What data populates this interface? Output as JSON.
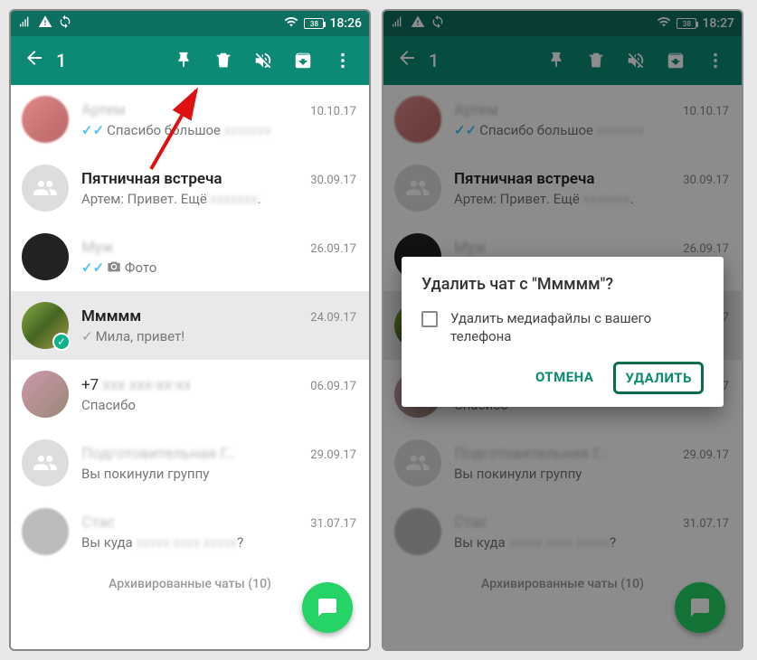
{
  "status": {
    "battery": "38",
    "time_left": "18:26",
    "time_right": "18:27"
  },
  "action_bar": {
    "selected_count": "1"
  },
  "chats": [
    {
      "name": "Артем",
      "name_blurred": true,
      "date": "10.10.17",
      "msg_prefix_ticks": true,
      "msg": "Спасибо большое",
      "msg_tail_blur": true
    },
    {
      "name": "Пятничная встреча",
      "date": "30.09.17",
      "group": true,
      "msg": "Артем: Привет. Ещё",
      "msg_tail_blur": true
    },
    {
      "name": "Муж",
      "name_blurred": true,
      "date": "26.09.17",
      "msg_prefix_ticks": true,
      "msg_icon_camera": true,
      "msg": "Фото"
    },
    {
      "name": "Ммммм",
      "date": "24.09.17",
      "selected": true,
      "msg_prefix_sent": true,
      "msg": "Мила, привет!"
    },
    {
      "name": "+7",
      "name_tail_blur": true,
      "date": "06.09.17",
      "msg": "Спасибо"
    },
    {
      "name": "Подготовительная Г…",
      "name_blurred": true,
      "date": "29.09.17",
      "group": true,
      "msg": "Вы покинули группу"
    },
    {
      "name": "Стас",
      "name_blurred": true,
      "date": "31.07.17",
      "msg": "Вы куда",
      "msg_tail_blur": true,
      "msg_tail_q": "?"
    }
  ],
  "archived": {
    "label": "Архивированные чаты (10)"
  },
  "dialog": {
    "title": "Удалить чат с \"Ммммм\"?",
    "checkbox_label": "Удалить медиафайлы с вашего телефона",
    "cancel": "ОТМЕНА",
    "confirm": "УДАЛИТЬ"
  }
}
